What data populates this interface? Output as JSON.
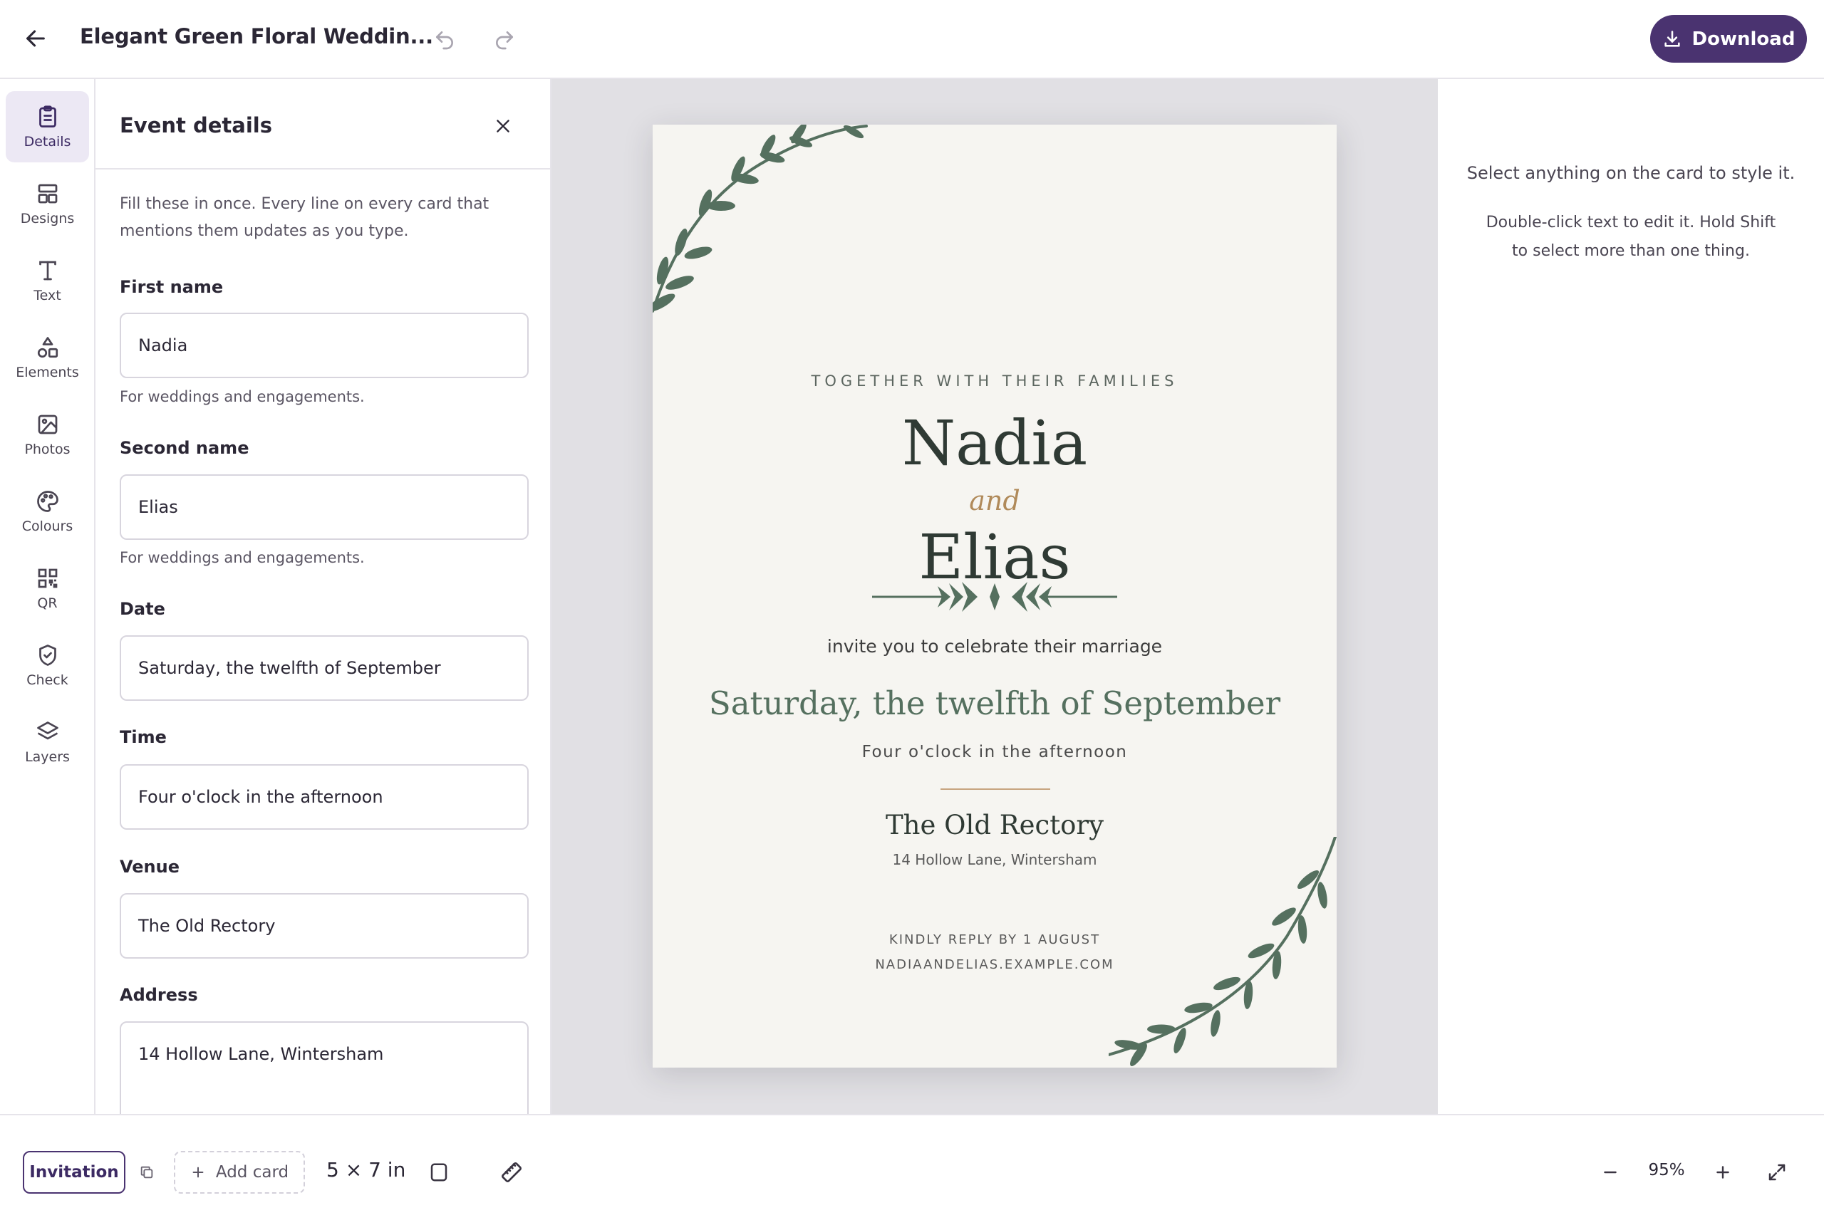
{
  "header": {
    "title": "Elegant Green Floral Weddin...",
    "download_label": "Download"
  },
  "rail": {
    "items": [
      {
        "label": "Details",
        "icon": "clipboard-icon",
        "active": true
      },
      {
        "label": "Designs",
        "icon": "layout-icon"
      },
      {
        "label": "Text",
        "icon": "text-icon"
      },
      {
        "label": "Elements",
        "icon": "shapes-icon"
      },
      {
        "label": "Photos",
        "icon": "image-icon"
      },
      {
        "label": "Colours",
        "icon": "palette-icon"
      },
      {
        "label": "QR",
        "icon": "qr-code-icon"
      },
      {
        "label": "Check",
        "icon": "shield-check-icon"
      },
      {
        "label": "Layers",
        "icon": "layers-icon"
      }
    ]
  },
  "panel": {
    "title": "Event details",
    "intro": "Fill these in once. Every line on every card that mentions them updates as you type.",
    "fields": {
      "first_name": {
        "label": "First name",
        "value": "Nadia",
        "help": "For weddings and engagements."
      },
      "second_name": {
        "label": "Second name",
        "value": "Elias",
        "help": "For weddings and engagements."
      },
      "date": {
        "label": "Date",
        "value": "Saturday, the twelfth of September"
      },
      "time": {
        "label": "Time",
        "value": "Four o'clock in the afternoon"
      },
      "venue": {
        "label": "Venue",
        "value": "The Old Rectory"
      },
      "address": {
        "label": "Address",
        "value": "14 Hollow Lane, Wintersham"
      }
    }
  },
  "card": {
    "eyebrow": "TOGETHER WITH THEIR FAMILIES",
    "name1": "Nadia",
    "and": "and",
    "name2": "Elias",
    "invite": "invite you to celebrate their marriage",
    "date": "Saturday, the twelfth of September",
    "time": "Four o'clock in the afternoon",
    "venue": "The Old Rectory",
    "address": "14 Hollow Lane, Wintersham",
    "reply": "KINDLY REPLY BY 1 AUGUST",
    "website": "NADIAANDELIAS.EXAMPLE.COM"
  },
  "right_panel": {
    "hint_primary": "Select anything on the card to style it.",
    "hint_secondary": "Double-click text to edit it. Hold Shift to select more than one thing."
  },
  "bottombar": {
    "card_tab": "Invitation",
    "add_card_label": "Add card",
    "size_label": "5 × 7 in",
    "zoom_level": "95%"
  },
  "colors": {
    "accent": "#4a3370",
    "leaf": "#55705f",
    "gold": "#b08a5a",
    "card_bg": "#f6f5f1",
    "canvas_bg": "#e1e0e4"
  }
}
